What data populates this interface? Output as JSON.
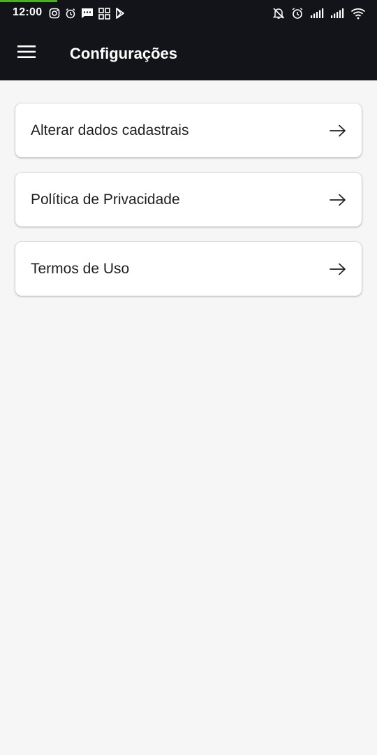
{
  "status_bar": {
    "time": "12:00",
    "left_icons": [
      "instagram-icon",
      "alarm-icon",
      "message-icon",
      "qr-code-icon",
      "play-store-icon"
    ],
    "right_icons": [
      "notifications-off-icon",
      "alarm-icon",
      "signal-icon",
      "signal-icon",
      "wifi-icon"
    ],
    "progress_color": "#4caf1e"
  },
  "app_bar": {
    "menu_icon": "hamburger-menu-icon",
    "title": "Configurações",
    "background": "#121419"
  },
  "settings": {
    "items": [
      {
        "label": "Alterar dados cadastrais",
        "icon": "arrow-right-icon"
      },
      {
        "label": "Política de Privacidade",
        "icon": "arrow-right-icon"
      },
      {
        "label": "Termos de Uso",
        "icon": "arrow-right-icon"
      }
    ]
  },
  "colors": {
    "background": "#f6f6f6",
    "card": "#ffffff",
    "text": "#1f1f1f"
  }
}
